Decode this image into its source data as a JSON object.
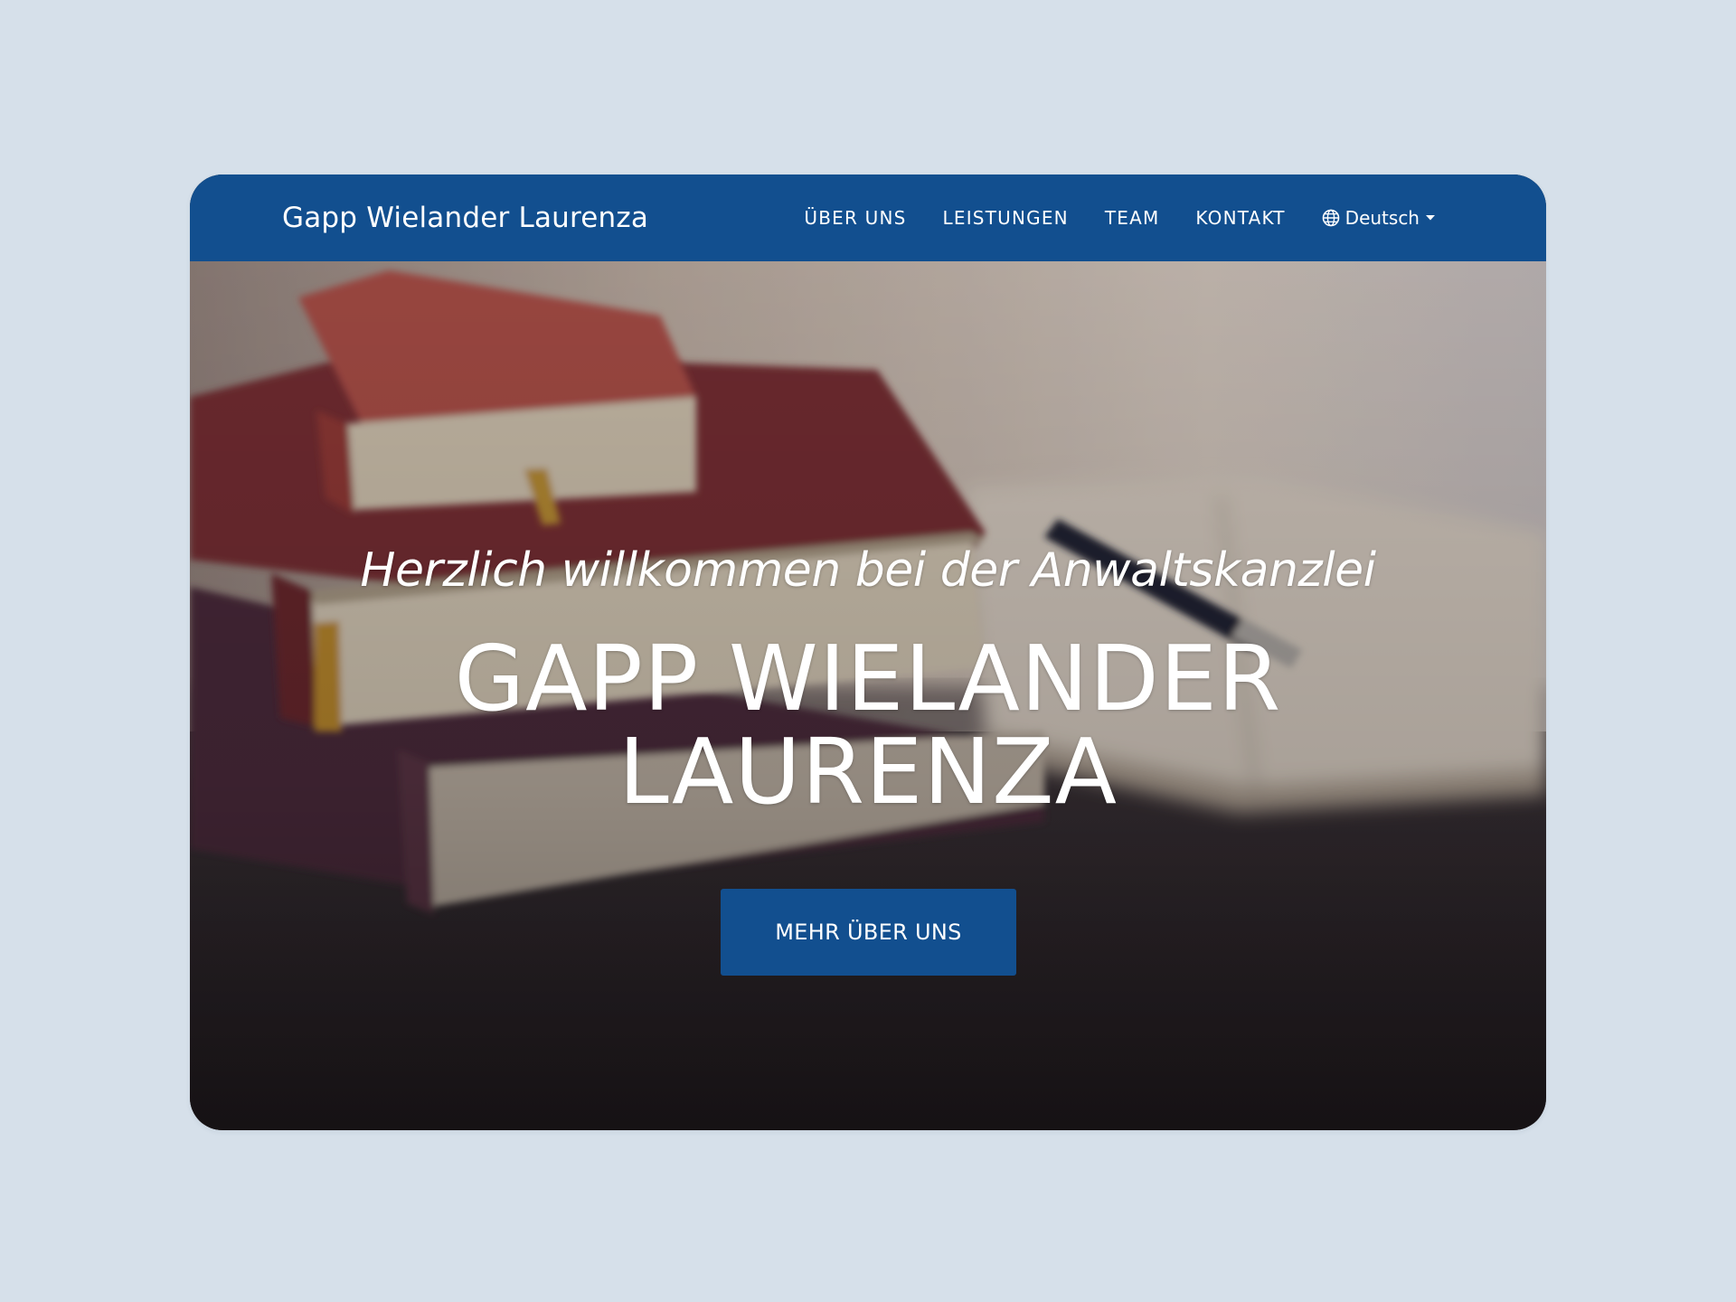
{
  "navbar": {
    "brand": "Gapp Wielander Laurenza",
    "links": [
      {
        "label": "ÜBER UNS"
      },
      {
        "label": "LEISTUNGEN"
      },
      {
        "label": "TEAM"
      },
      {
        "label": "KONTAKT"
      }
    ],
    "language": {
      "label": "Deutsch",
      "icon": "globe-icon"
    }
  },
  "hero": {
    "subtitle": "Herzlich willkommen bei der Anwaltskanzlei",
    "title_line_1": "GAPP WIELANDER",
    "title_line_2": "LAURENZA",
    "cta_label": "MEHR ÜBER UNS"
  },
  "colors": {
    "page_background": "#d6e0ea",
    "primary": "#124f8f",
    "text_on_primary": "#ffffff"
  }
}
